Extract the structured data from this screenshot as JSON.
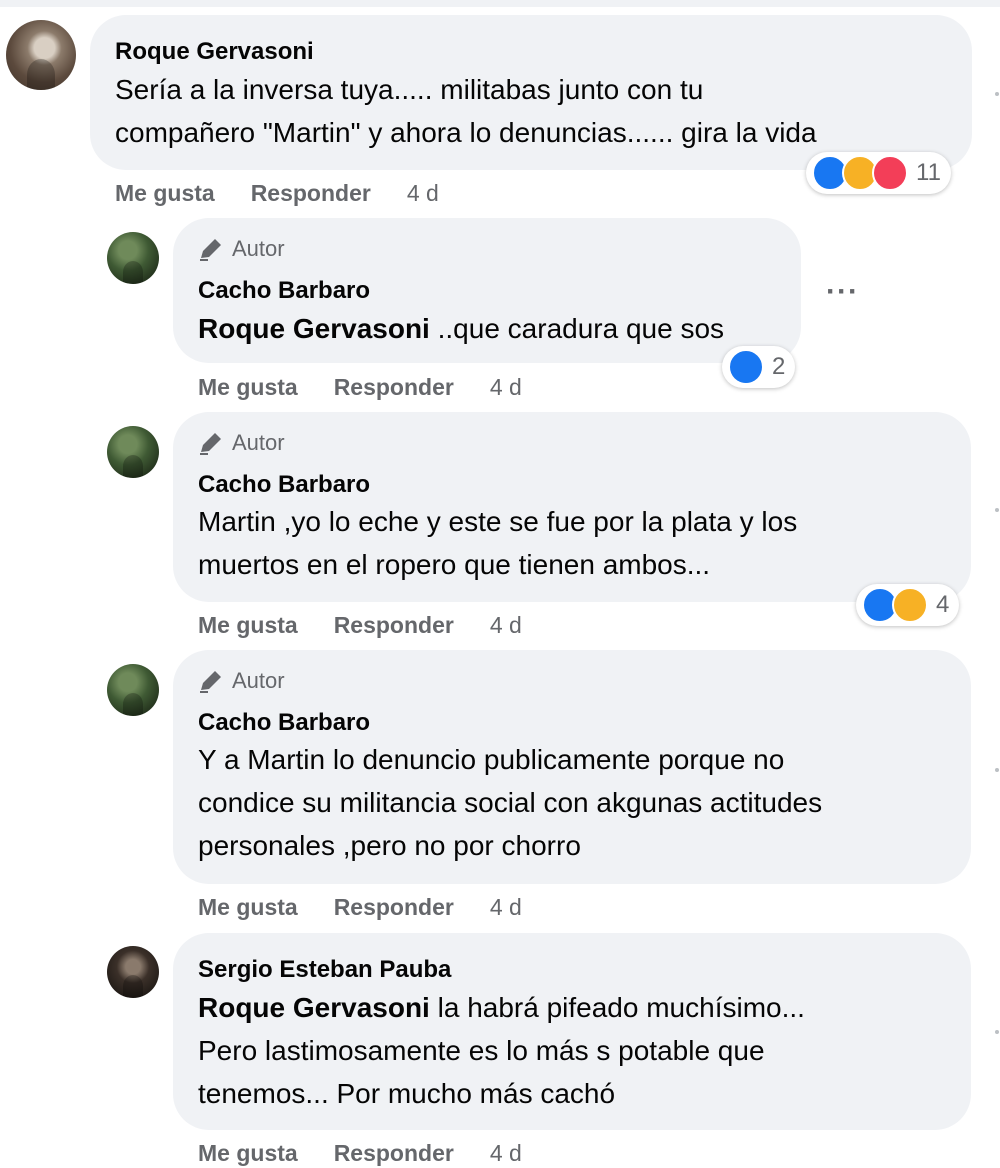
{
  "comments": [
    {
      "author": "Roque Gervasoni",
      "lines": [
        "Sería a la inversa tuya..... militabas junto con tu",
        "compañero \"Martin\" y ahora lo denuncias...... gira la vida"
      ],
      "actions": {
        "like": "Me gusta",
        "reply": "Responder",
        "time": "4 d"
      },
      "reactions": {
        "icons": [
          "like-icon",
          "care-icon",
          "love-icon"
        ],
        "count": "11"
      }
    },
    {
      "badge": "Autor",
      "author": "Cacho Barbaro",
      "mention": "Roque Gervasoni",
      "lines": [
        " ..que caradura que sos"
      ],
      "actions": {
        "like": "Me gusta",
        "reply": "Responder",
        "time": "4 d"
      },
      "reactions": {
        "icons": [
          "like-icon"
        ],
        "count": "2"
      },
      "more": "···"
    },
    {
      "badge": "Autor",
      "author": "Cacho Barbaro",
      "lines": [
        "Martin ,yo lo eche y este se fue por la plata y los",
        "muertos en el ropero que tienen ambos..."
      ],
      "actions": {
        "like": "Me gusta",
        "reply": "Responder",
        "time": "4 d"
      },
      "reactions": {
        "icons": [
          "like-icon",
          "haha-icon"
        ],
        "count": "4"
      }
    },
    {
      "badge": "Autor",
      "author": "Cacho Barbaro",
      "lines": [
        "Y a Martin lo denuncio publicamente porque no",
        "condice su militancia social con akgunas actitudes",
        "personales ,pero no por chorro"
      ],
      "actions": {
        "like": "Me gusta",
        "reply": "Responder",
        "time": "4 d"
      }
    },
    {
      "author": "Sergio Esteban Pauba",
      "mention": "Roque Gervasoni",
      "lines": [
        " la habrá pifeado muchísimo...",
        "Pero lastimosamente es lo más s potable que",
        "tenemos... Por mucho más cachó"
      ],
      "actions": {
        "like": "Me gusta",
        "reply": "Responder",
        "time": "4 d"
      }
    }
  ],
  "colors": {
    "bubble": "#f0f2f5",
    "secondary_text": "#65676b",
    "like": "#1877f2",
    "love": "#f33e58",
    "care": "#f7b125"
  }
}
